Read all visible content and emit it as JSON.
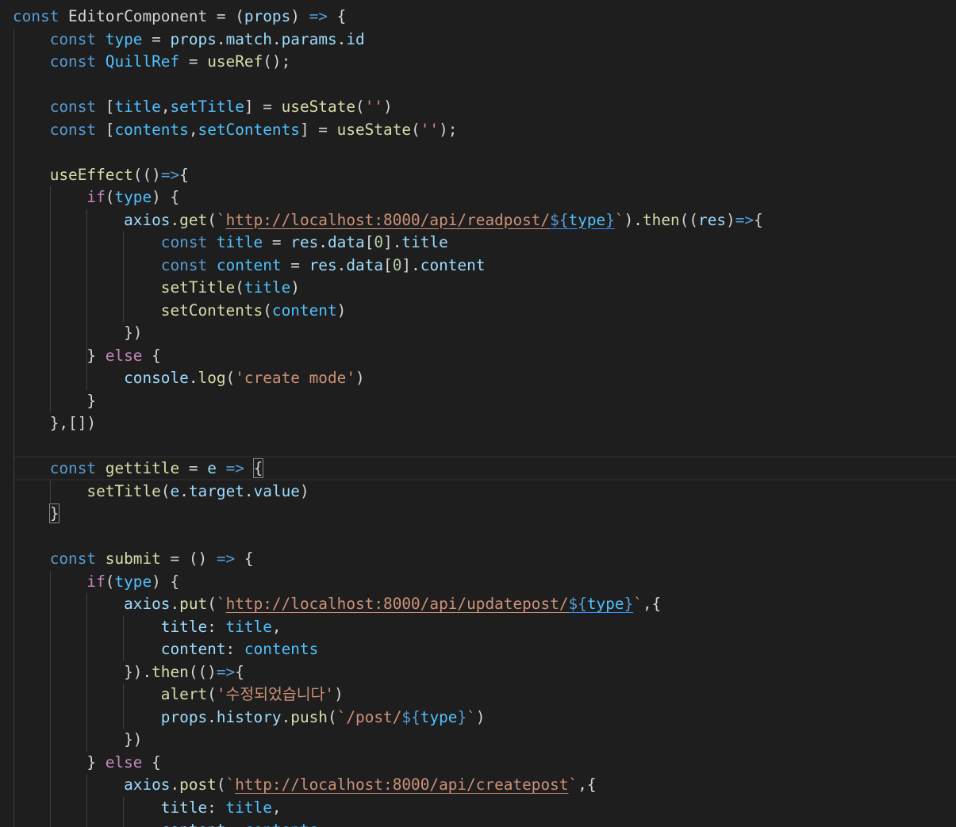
{
  "editor": {
    "lines": [
      [
        {
          "t": "const",
          "c": "kw"
        },
        {
          "t": " EditorComponent ",
          "c": "pun"
        },
        {
          "t": "=",
          "c": "pun"
        },
        {
          "t": " (",
          "c": "pun"
        },
        {
          "t": "props",
          "c": "var"
        },
        {
          "t": ") ",
          "c": "pun"
        },
        {
          "t": "=>",
          "c": "kw"
        },
        {
          "t": " {",
          "c": "pun"
        }
      ],
      [
        {
          "t": "    "
        },
        {
          "t": "const",
          "c": "kw"
        },
        {
          "t": " "
        },
        {
          "t": "type",
          "c": "cst"
        },
        {
          "t": " = "
        },
        {
          "t": "props",
          "c": "var"
        },
        {
          "t": "."
        },
        {
          "t": "match",
          "c": "var"
        },
        {
          "t": "."
        },
        {
          "t": "params",
          "c": "var"
        },
        {
          "t": "."
        },
        {
          "t": "id",
          "c": "var"
        }
      ],
      [
        {
          "t": "    "
        },
        {
          "t": "const",
          "c": "kw"
        },
        {
          "t": " "
        },
        {
          "t": "QuillRef",
          "c": "cst"
        },
        {
          "t": " = "
        },
        {
          "t": "useRef",
          "c": "fn"
        },
        {
          "t": "();"
        }
      ],
      [],
      [
        {
          "t": "    "
        },
        {
          "t": "const",
          "c": "kw"
        },
        {
          "t": " ["
        },
        {
          "t": "title",
          "c": "cst"
        },
        {
          "t": ","
        },
        {
          "t": "setTitle",
          "c": "cst"
        },
        {
          "t": "] = "
        },
        {
          "t": "useState",
          "c": "fn"
        },
        {
          "t": "("
        },
        {
          "t": "''",
          "c": "str"
        },
        {
          "t": ")"
        }
      ],
      [
        {
          "t": "    "
        },
        {
          "t": "const",
          "c": "kw"
        },
        {
          "t": " ["
        },
        {
          "t": "contents",
          "c": "cst"
        },
        {
          "t": ","
        },
        {
          "t": "setContents",
          "c": "cst"
        },
        {
          "t": "] = "
        },
        {
          "t": "useState",
          "c": "fn"
        },
        {
          "t": "("
        },
        {
          "t": "''",
          "c": "str"
        },
        {
          "t": ");"
        }
      ],
      [],
      [
        {
          "t": "    "
        },
        {
          "t": "useEffect",
          "c": "fn"
        },
        {
          "t": "(()"
        },
        {
          "t": "=>",
          "c": "kw"
        },
        {
          "t": "{"
        }
      ],
      [
        {
          "t": "        "
        },
        {
          "t": "if",
          "c": "ctl"
        },
        {
          "t": "("
        },
        {
          "t": "type",
          "c": "cst"
        },
        {
          "t": ") {"
        }
      ],
      [
        {
          "t": "            "
        },
        {
          "t": "axios",
          "c": "var"
        },
        {
          "t": "."
        },
        {
          "t": "get",
          "c": "fn"
        },
        {
          "t": "("
        },
        {
          "t": "`",
          "c": "str"
        },
        {
          "t": "http://localhost:8000/api/readpost/",
          "c": "url"
        },
        {
          "t": "${",
          "c": "tpl ul-blue"
        },
        {
          "t": "type",
          "c": "cst ul-blue"
        },
        {
          "t": "}",
          "c": "tpl ul-blue"
        },
        {
          "t": "`",
          "c": "str"
        },
        {
          "t": ")."
        },
        {
          "t": "then",
          "c": "fn"
        },
        {
          "t": "(("
        },
        {
          "t": "res",
          "c": "var"
        },
        {
          "t": ")"
        },
        {
          "t": "=>",
          "c": "kw"
        },
        {
          "t": "{"
        }
      ],
      [
        {
          "t": "                "
        },
        {
          "t": "const",
          "c": "kw"
        },
        {
          "t": " "
        },
        {
          "t": "title",
          "c": "cst"
        },
        {
          "t": " = "
        },
        {
          "t": "res",
          "c": "var"
        },
        {
          "t": "."
        },
        {
          "t": "data",
          "c": "var"
        },
        {
          "t": "["
        },
        {
          "t": "0",
          "c": "num"
        },
        {
          "t": "]."
        },
        {
          "t": "title",
          "c": "var"
        }
      ],
      [
        {
          "t": "                "
        },
        {
          "t": "const",
          "c": "kw"
        },
        {
          "t": " "
        },
        {
          "t": "content",
          "c": "cst"
        },
        {
          "t": " = "
        },
        {
          "t": "res",
          "c": "var"
        },
        {
          "t": "."
        },
        {
          "t": "data",
          "c": "var"
        },
        {
          "t": "["
        },
        {
          "t": "0",
          "c": "num"
        },
        {
          "t": "]."
        },
        {
          "t": "content",
          "c": "var"
        }
      ],
      [
        {
          "t": "                "
        },
        {
          "t": "setTitle",
          "c": "fn"
        },
        {
          "t": "("
        },
        {
          "t": "title",
          "c": "cst"
        },
        {
          "t": ")"
        }
      ],
      [
        {
          "t": "                "
        },
        {
          "t": "setContents",
          "c": "fn"
        },
        {
          "t": "("
        },
        {
          "t": "content",
          "c": "cst"
        },
        {
          "t": ")"
        }
      ],
      [
        {
          "t": "            })"
        }
      ],
      [
        {
          "t": "        } "
        },
        {
          "t": "else",
          "c": "ctl"
        },
        {
          "t": " {"
        }
      ],
      [
        {
          "t": "            "
        },
        {
          "t": "console",
          "c": "var"
        },
        {
          "t": "."
        },
        {
          "t": "log",
          "c": "fn"
        },
        {
          "t": "("
        },
        {
          "t": "'create mode'",
          "c": "str"
        },
        {
          "t": ")"
        }
      ],
      [
        {
          "t": "        }"
        }
      ],
      [
        {
          "t": "    },[])"
        }
      ],
      [],
      [
        {
          "t": "    "
        },
        {
          "t": "const",
          "c": "kw"
        },
        {
          "t": " "
        },
        {
          "t": "gettitle",
          "c": "fn"
        },
        {
          "t": " = "
        },
        {
          "t": "e",
          "c": "var"
        },
        {
          "t": " "
        },
        {
          "t": "=>",
          "c": "kw"
        },
        {
          "t": " "
        },
        {
          "t": "{",
          "c": "pun bracket-match"
        }
      ],
      [
        {
          "t": "        "
        },
        {
          "t": "setTitle",
          "c": "fn"
        },
        {
          "t": "("
        },
        {
          "t": "e",
          "c": "var"
        },
        {
          "t": "."
        },
        {
          "t": "target",
          "c": "var"
        },
        {
          "t": "."
        },
        {
          "t": "value",
          "c": "var"
        },
        {
          "t": ")"
        }
      ],
      [
        {
          "t": "    "
        },
        {
          "t": "}",
          "c": "pun bracket-match"
        }
      ],
      [],
      [
        {
          "t": "    "
        },
        {
          "t": "const",
          "c": "kw"
        },
        {
          "t": " "
        },
        {
          "t": "submit",
          "c": "fn"
        },
        {
          "t": " = () "
        },
        {
          "t": "=>",
          "c": "kw"
        },
        {
          "t": " {"
        }
      ],
      [
        {
          "t": "        "
        },
        {
          "t": "if",
          "c": "ctl"
        },
        {
          "t": "("
        },
        {
          "t": "type",
          "c": "cst"
        },
        {
          "t": ") {"
        }
      ],
      [
        {
          "t": "            "
        },
        {
          "t": "axios",
          "c": "var"
        },
        {
          "t": "."
        },
        {
          "t": "put",
          "c": "fn"
        },
        {
          "t": "("
        },
        {
          "t": "`",
          "c": "str"
        },
        {
          "t": "http://localhost:8000/api/updatepost/",
          "c": "url"
        },
        {
          "t": "${",
          "c": "tpl ul-blue"
        },
        {
          "t": "type",
          "c": "cst ul-blue"
        },
        {
          "t": "}",
          "c": "tpl ul-blue"
        },
        {
          "t": "`",
          "c": "str"
        },
        {
          "t": ",{"
        }
      ],
      [
        {
          "t": "                "
        },
        {
          "t": "title",
          "c": "var"
        },
        {
          "t": ": "
        },
        {
          "t": "title",
          "c": "cst"
        },
        {
          "t": ","
        }
      ],
      [
        {
          "t": "                "
        },
        {
          "t": "content",
          "c": "var"
        },
        {
          "t": ": "
        },
        {
          "t": "contents",
          "c": "cst"
        }
      ],
      [
        {
          "t": "            })."
        },
        {
          "t": "then",
          "c": "fn"
        },
        {
          "t": "(()"
        },
        {
          "t": "=>",
          "c": "kw"
        },
        {
          "t": "{"
        }
      ],
      [
        {
          "t": "                "
        },
        {
          "t": "alert",
          "c": "fn"
        },
        {
          "t": "("
        },
        {
          "t": "'수정되었습니다'",
          "c": "str"
        },
        {
          "t": ")"
        }
      ],
      [
        {
          "t": "                "
        },
        {
          "t": "props",
          "c": "var"
        },
        {
          "t": "."
        },
        {
          "t": "history",
          "c": "var"
        },
        {
          "t": "."
        },
        {
          "t": "push",
          "c": "fn"
        },
        {
          "t": "("
        },
        {
          "t": "`/post/",
          "c": "str"
        },
        {
          "t": "${",
          "c": "tpl"
        },
        {
          "t": "type",
          "c": "cst"
        },
        {
          "t": "}",
          "c": "tpl"
        },
        {
          "t": "`",
          "c": "str"
        },
        {
          "t": ")"
        }
      ],
      [
        {
          "t": "            })"
        }
      ],
      [
        {
          "t": "        } "
        },
        {
          "t": "else",
          "c": "ctl"
        },
        {
          "t": " {"
        }
      ],
      [
        {
          "t": "            "
        },
        {
          "t": "axios",
          "c": "var"
        },
        {
          "t": "."
        },
        {
          "t": "post",
          "c": "fn"
        },
        {
          "t": "("
        },
        {
          "t": "`",
          "c": "str"
        },
        {
          "t": "http://localhost:8000/api/createpost",
          "c": "url"
        },
        {
          "t": "`",
          "c": "str"
        },
        {
          "t": ",{"
        }
      ],
      [
        {
          "t": "                "
        },
        {
          "t": "title",
          "c": "var"
        },
        {
          "t": ": "
        },
        {
          "t": "title",
          "c": "cst"
        },
        {
          "t": ","
        }
      ],
      [
        {
          "t": "                "
        },
        {
          "t": "content",
          "c": "var"
        },
        {
          "t": ": "
        },
        {
          "t": "contents",
          "c": "cst"
        }
      ]
    ]
  }
}
